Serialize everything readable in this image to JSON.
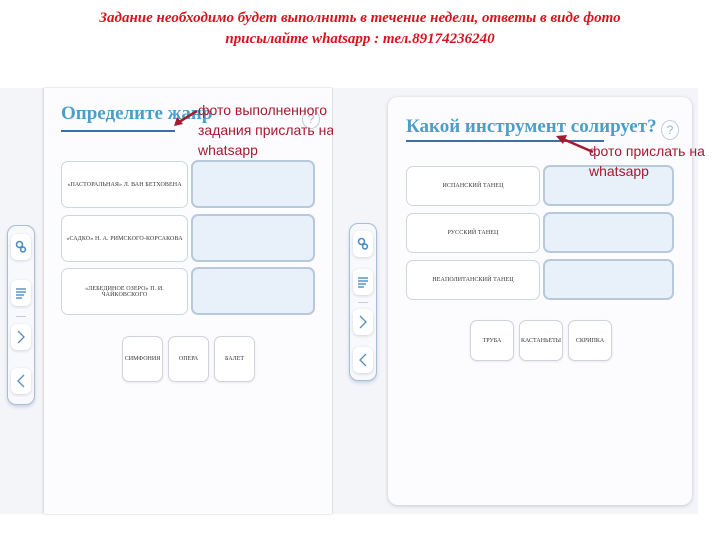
{
  "header": {
    "line1": "Задание необходимо будет выполнить в течение недели, ответы  в виде  фото",
    "line2": "присылайте  whatsapp : тел.89174236240"
  },
  "colors": {
    "header_red": "#d8131d",
    "title_blue": "#4a9fc9",
    "annotation_red": "#a6192e",
    "slot_fill": "#e8f0fa"
  },
  "left_task": {
    "title": "Определите жанр",
    "help_label": "?",
    "annotation": {
      "line1": "фото выполненного",
      "line2": "задания прислать на",
      "line3": "whatsapp"
    },
    "items": [
      {
        "label": "«ПАСТОРАЛЬНАЯ» Л. ВАН БЕТХОВЕНА"
      },
      {
        "label": "«САДКО» Н. А. РИМСКОГО-КОРСАКОВА"
      },
      {
        "label": "«ЛЕБЕДИНОЕ ОЗЕРО» П. И. ЧАЙКОВСКОГО"
      }
    ],
    "options": [
      {
        "label": "СИМФОНИЯ"
      },
      {
        "label": "ОПЕРА"
      },
      {
        "label": "БАЛЕТ"
      }
    ]
  },
  "right_task": {
    "title": "Какой инструмент солирует?",
    "help_label": "?",
    "annotation": {
      "line1": "фото прислать на",
      "line2": "whatsapp"
    },
    "items": [
      {
        "label": "ИСПАНСКИЙ ТАНЕЦ"
      },
      {
        "label": "РУССКИЙ ТАНЕЦ"
      },
      {
        "label": "НЕАПОЛИТАНСКИЙ ТАНЕЦ"
      }
    ],
    "options": [
      {
        "label": "ТРУБА"
      },
      {
        "label": "КАСТАНЬЕТЫ"
      },
      {
        "label": "СКРИПКА"
      }
    ]
  },
  "toolbar": {
    "icons": [
      "settings-icon",
      "list-icon",
      "chevron-right-icon",
      "chevron-left-icon"
    ]
  }
}
